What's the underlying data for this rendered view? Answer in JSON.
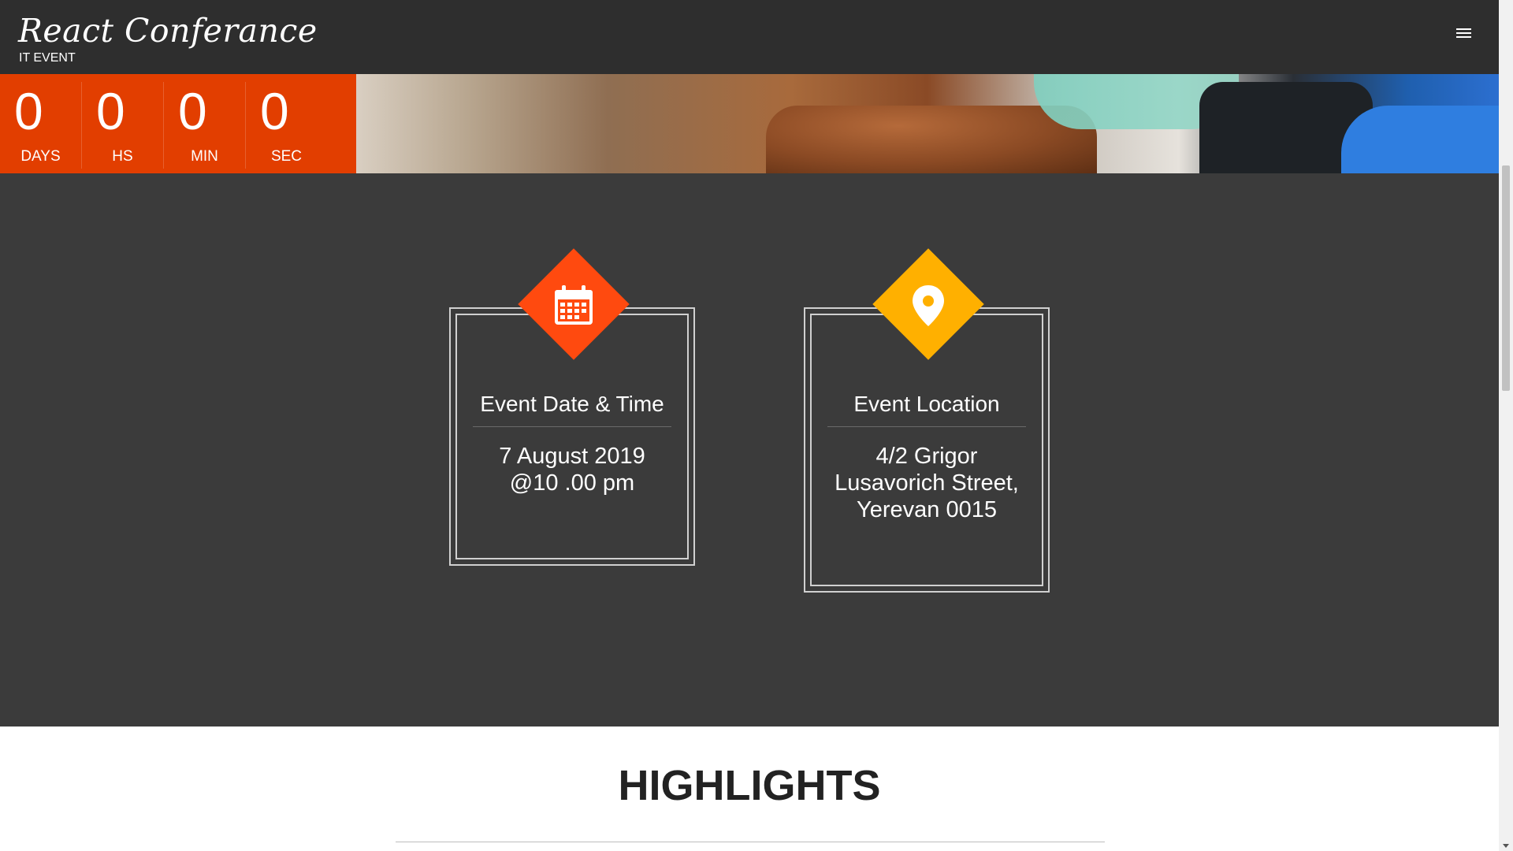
{
  "header": {
    "title": "React Conferance",
    "subtitle": "IT EVENT",
    "menu_icon": "hamburger-menu-icon"
  },
  "countdown": [
    {
      "value": "0",
      "label": "DAYS"
    },
    {
      "value": "0",
      "label": "HS"
    },
    {
      "value": "0",
      "label": "MIN"
    },
    {
      "value": "0",
      "label": "SEC"
    }
  ],
  "cards": {
    "date": {
      "icon": "calendar-icon",
      "title": "Event Date & Time",
      "line1": "7 August 2019",
      "line2": "@10 .00 pm"
    },
    "location": {
      "icon": "map-pin-icon",
      "title": "Event Location",
      "line1": "4/2 Grigor",
      "line2": "Lusavorich Street,",
      "line3": "Yerevan 0015"
    }
  },
  "highlights": {
    "title": "HIGHLIGHTS"
  },
  "colors": {
    "header_bg": "#2e2e2e",
    "countdown_bg": "#e23e00",
    "section_bg": "#3b3b3b",
    "accent_red": "#ff4a0f",
    "accent_gold": "#ffb000"
  }
}
